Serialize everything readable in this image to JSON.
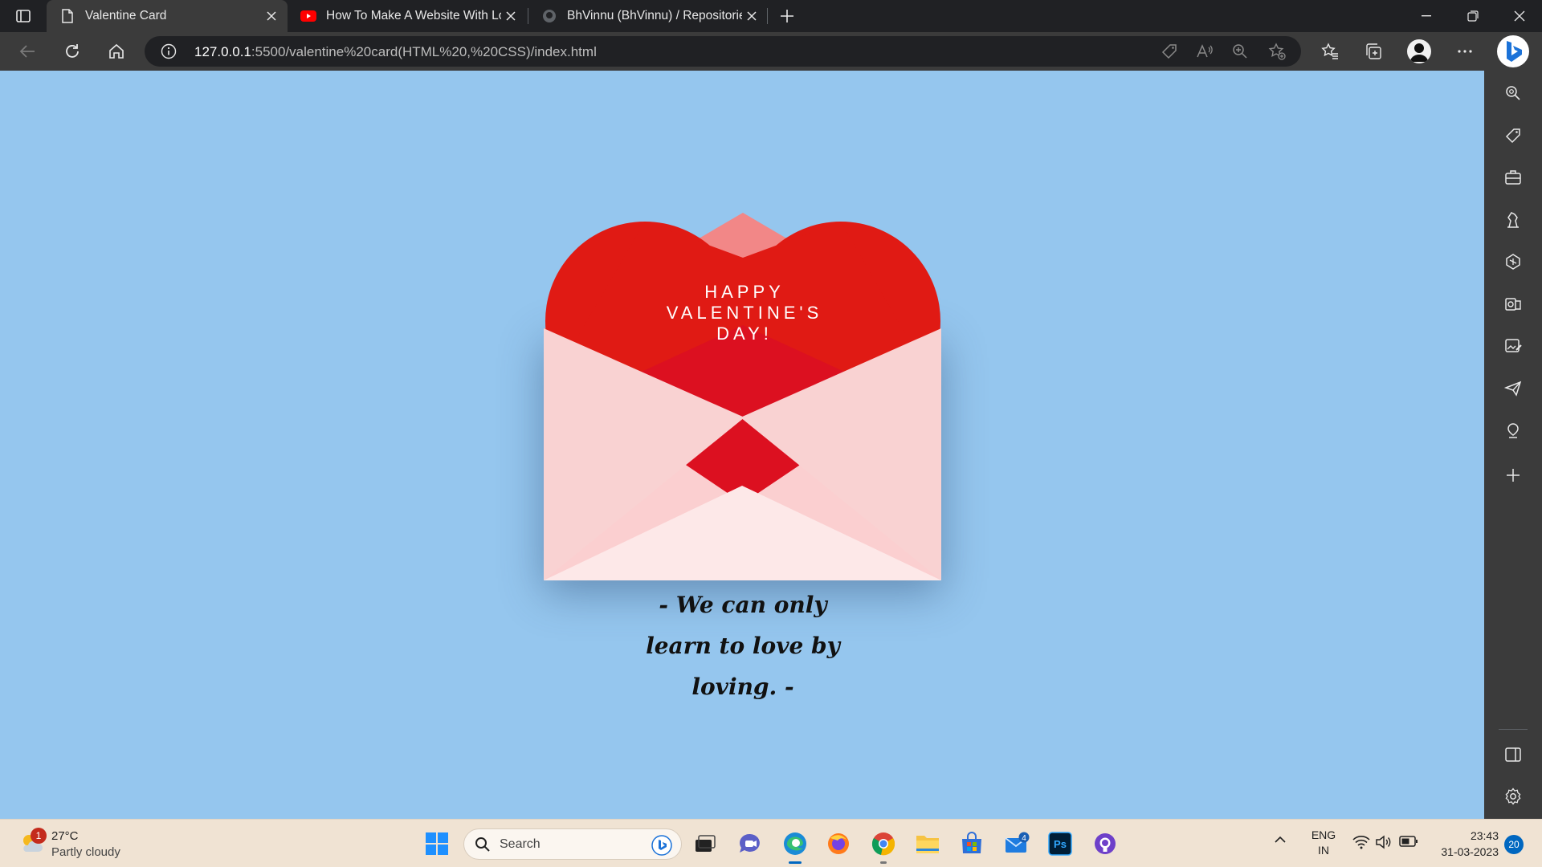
{
  "browser": {
    "tabs": [
      {
        "title": "Valentine Card",
        "icon": "document-icon",
        "active": true
      },
      {
        "title": "How To Make A Website With Lo",
        "icon": "youtube-icon",
        "active": false
      },
      {
        "title": "BhVinnu (BhVinnu) / Repositories",
        "icon": "github-icon",
        "active": false
      }
    ],
    "address": {
      "host": "127.0.0.1",
      "rest": ":5500/valentine%20card(HTML%20,%20CSS)/index.html"
    }
  },
  "page": {
    "background_color": "#95c6ee",
    "heart_color": "#e01a14",
    "card_message": [
      "HAPPY",
      "VALENTINE'S",
      "DAY!"
    ],
    "quote_lines": [
      "- We can only",
      "learn to love by",
      "loving.  -"
    ]
  },
  "taskbar": {
    "weather": {
      "temp": "27°C",
      "condition": "Partly cloudy",
      "badge": "1"
    },
    "search_placeholder": "Search",
    "mail_badge": "4",
    "lang": [
      "ENG",
      "IN"
    ],
    "time": "23:43",
    "date": "31-03-2023",
    "notifications": "20"
  }
}
